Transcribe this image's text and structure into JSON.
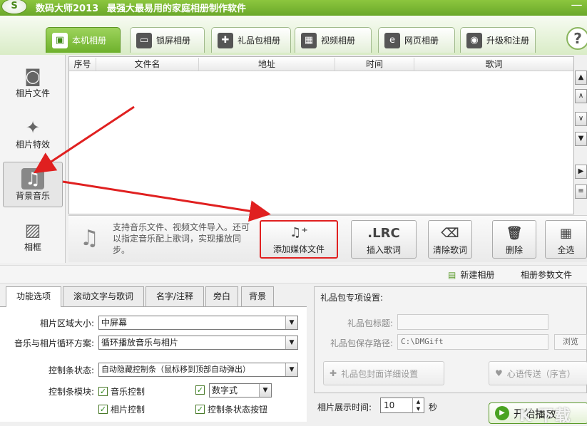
{
  "app": {
    "logo": "S",
    "title": "数码大师2013",
    "slogan": "最强大最易用的家庭相册制作软件",
    "min_icon": "—",
    "help": "?"
  },
  "main_tabs": [
    {
      "label": "本机相册",
      "icon": "photo-frame-icon",
      "glyph": "▣",
      "active": true
    },
    {
      "label": "锁屏相册",
      "icon": "monitor-icon",
      "glyph": "▭",
      "active": false
    },
    {
      "label": "礼品包相册",
      "icon": "gift-icon",
      "glyph": "✚",
      "active": false
    },
    {
      "label": "视频相册",
      "icon": "film-icon",
      "glyph": "▦",
      "active": false
    },
    {
      "label": "网页相册",
      "icon": "ie-icon",
      "glyph": "e",
      "active": false
    },
    {
      "label": "升级和注册",
      "icon": "globe-icon",
      "glyph": "◉",
      "active": false
    }
  ],
  "left_nav": [
    {
      "label": "相片文件",
      "icon": "camera-icon",
      "glyph": "◙"
    },
    {
      "label": "相片特效",
      "icon": "sparkle-icon",
      "glyph": "✦"
    },
    {
      "label": "背景音乐",
      "icon": "music-icon",
      "glyph": "♫",
      "selected": true
    },
    {
      "label": "相框",
      "icon": "picture-frame-icon",
      "glyph": "▨"
    }
  ],
  "list": {
    "columns": [
      "序号",
      "文件名",
      "地址",
      "时间",
      "歌词"
    ]
  },
  "side_tools": [
    "▲",
    "∧",
    "∨",
    "▼",
    "▶",
    "≡"
  ],
  "toolbar": {
    "music_glyph": "♫",
    "tip": "支持音乐文件、视频文件导入。还可以指定音乐配上歌词，实现播放同步。",
    "buttons": [
      {
        "label": "添加媒体文件",
        "glyph": "♫⁺"
      },
      {
        "label": "插入歌词",
        "glyph": ".LRC"
      },
      {
        "label": "清除歌词",
        "glyph": "⌫"
      },
      {
        "label": "删除",
        "glyph": "🗑"
      },
      {
        "label": "全选",
        "glyph": "▦"
      }
    ]
  },
  "strip": {
    "new_album": "新建相册",
    "album_params": "相册参数文件"
  },
  "lower_tabs": [
    "功能选项",
    "滚动文字与歌词",
    "名字/注释",
    "旁白",
    "背景"
  ],
  "options": {
    "area_size_label": "相片区域大小:",
    "area_size_value": "中屏幕",
    "loop_label": "音乐与相片循环方案:",
    "loop_value": "循环播放音乐与相片",
    "ctrlbar_state_label": "控制条状态:",
    "ctrlbar_state_value": "自动隐藏控制条（鼠标移到顶部自动弹出）",
    "ctrlbar_module_label": "控制条模块:",
    "modules": [
      {
        "label": "音乐控制",
        "checked": true
      },
      {
        "label": "数字式",
        "checked": true,
        "dropdown": true
      },
      {
        "label": "相片控制",
        "checked": true
      },
      {
        "label": "控制条状态按钮",
        "checked": true
      }
    ]
  },
  "gift": {
    "title": "礼品包专项设置:",
    "name_label": "礼品包标题:",
    "name_value": "",
    "path_label": "礼品包保存路径:",
    "path_value": "C:\\DMGift",
    "browse": "浏览",
    "cover_button": "礼品包封面详细设置",
    "message_button": "心语传送（序言）"
  },
  "show_time": {
    "label": "相片展示时间:",
    "value": "10",
    "unit": "秒"
  },
  "start_button": "开始播放",
  "watermark": "K 下载"
}
